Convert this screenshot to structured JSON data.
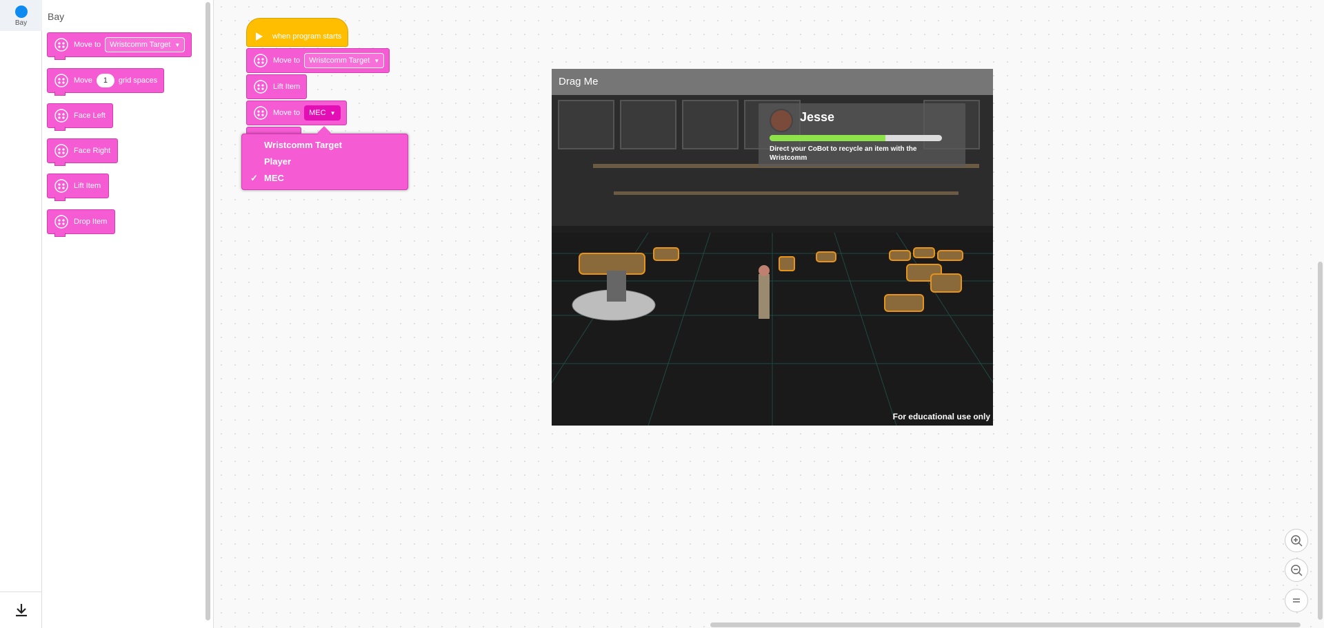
{
  "category": {
    "label": "Bay"
  },
  "flyout": {
    "title": "Bay",
    "blocks": [
      {
        "label": "Move to",
        "dropdown": "Wristcomm Target"
      },
      {
        "label_pre": "Move",
        "value": "1",
        "label_post": "grid spaces"
      },
      {
        "label": "Face Left"
      },
      {
        "label": "Face Right"
      },
      {
        "label": "Lift Item"
      },
      {
        "label": "Drop Item"
      }
    ]
  },
  "program": {
    "hat_label": "when program starts",
    "blocks": [
      {
        "label": "Move to",
        "dropdown": "Wristcomm Target"
      },
      {
        "label": "Lift Item"
      },
      {
        "label": "Move to",
        "dropdown": "MEC"
      }
    ]
  },
  "dropdown_menu": {
    "options": [
      "Wristcomm Target",
      "Player",
      "MEC"
    ],
    "selected": "MEC",
    "check": "✓"
  },
  "game": {
    "title": "Drag Me",
    "hud_name": "Jesse",
    "hud_progress": 0.67,
    "hud_text": "Direct your CoBot to recycle  an item with the Wristcomm",
    "footer": "For educational use only"
  },
  "colors": {
    "block": "#f55bd3",
    "hat": "#ffbf00",
    "category_dot": "#0e8bf0"
  },
  "icons": {
    "block_icon": "robot-icon",
    "export": "download-icon",
    "zoom_in": "zoom-in-icon",
    "zoom_out": "zoom-out-icon",
    "reset": "reset-zoom-icon"
  }
}
